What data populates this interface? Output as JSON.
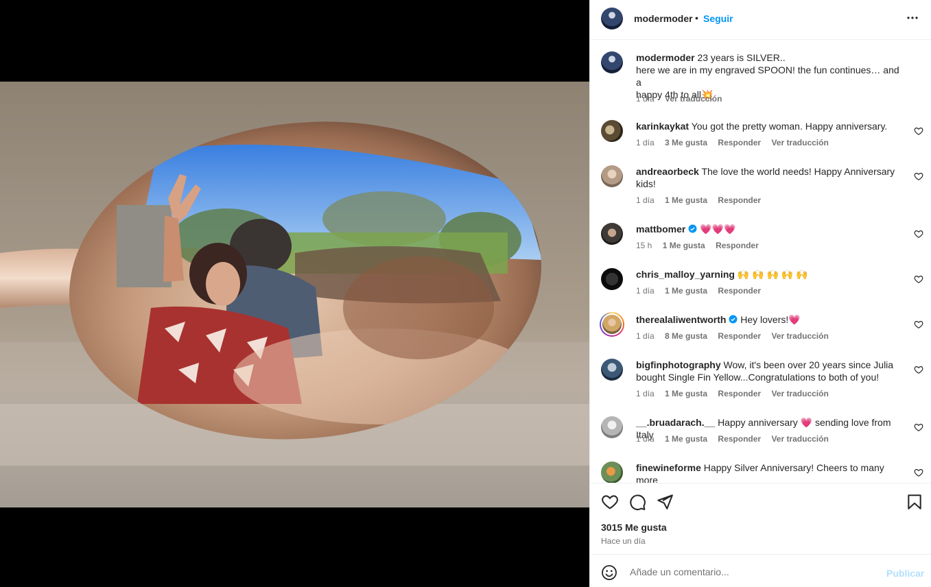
{
  "post": {
    "owner": "modermoder",
    "follow_label": "Seguir",
    "separator": "•",
    "more_icon": "more-horizontal-icon",
    "caption_user": "modermoder",
    "caption_line1": "23 years is SILVER..",
    "caption_line2": "here we are in my engraved SPOON! the fun continues… and a",
    "caption_line3": "happy 4th to all💥",
    "caption_time": "1 día",
    "caption_translate": "Ver traducción"
  },
  "comments": [
    {
      "user": "karinkaykat",
      "text": "You got the pretty woman. Happy anniversary.",
      "time": "1 día",
      "likes": "3 Me gusta",
      "reply": "Responder",
      "translate": "Ver traducción"
    },
    {
      "user": "andreaorbeck",
      "text": "The love the world needs! Happy Anniversary",
      "text2": "kids!",
      "time": "1 día",
      "likes": "1 Me gusta",
      "reply": "Responder"
    },
    {
      "user": "mattbomer",
      "verified": true,
      "text": "💗💗💗",
      "time": "15 h",
      "likes": "1 Me gusta",
      "reply": "Responder"
    },
    {
      "user": "chris_malloy_yarning",
      "text": "🙌 🙌 🙌 🙌 🙌",
      "time": "1 día",
      "likes": "1 Me gusta",
      "reply": "Responder"
    },
    {
      "user": "therealaliwentworth",
      "verified": true,
      "text": "Hey lovers!💗",
      "time": "1 día",
      "likes": "8 Me gusta",
      "reply": "Responder",
      "translate": "Ver traducción"
    },
    {
      "user": "bigfinphotography",
      "text": "Wow, it's been over 20 years since Julia",
      "text2": "bought Single Fin Yellow...Congratulations to both of you!",
      "time": "1 día",
      "likes": "1 Me gusta",
      "reply": "Responder",
      "translate": "Ver traducción"
    },
    {
      "user": "__.bruadarach.__",
      "text": "Happy anniversary 💗 sending love from Italy",
      "time": "1 día",
      "likes": "1 Me gusta",
      "reply": "Responder",
      "translate": "Ver traducción"
    },
    {
      "user": "finewineforme",
      "text": "Happy Silver Anniversary! Cheers to many more",
      "text2": "🍾🥂🎉"
    }
  ],
  "actions": {
    "icons": [
      "heart-icon",
      "comment-icon",
      "share-icon",
      "bookmark-icon"
    ],
    "likes_count": "3015 Me gusta",
    "posted": "Hace un día"
  },
  "composer": {
    "placeholder": "Añade un comentario...",
    "publish_label": "Publicar",
    "emoji_icon": "emoji-icon"
  },
  "colors": {
    "link_blue": "#0095f6",
    "publish_disabled": "#b2dffc",
    "verified": "#0095f6",
    "muted_text": "#737373"
  }
}
